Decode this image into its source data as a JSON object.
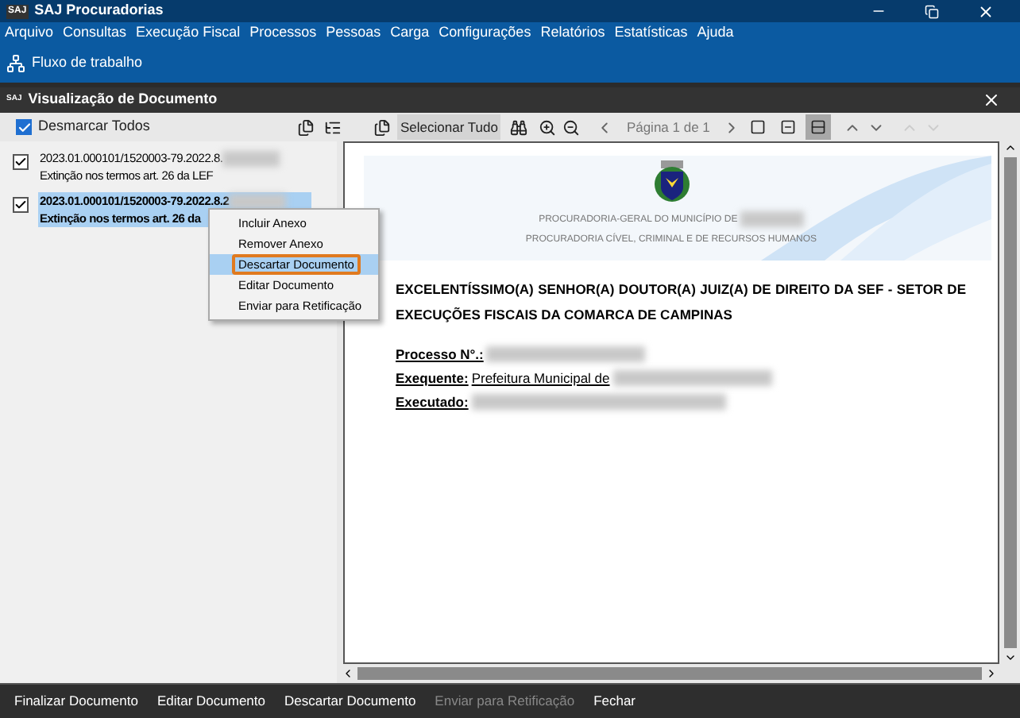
{
  "window": {
    "title": "SAJ Procuradorias",
    "logo": "SAJ"
  },
  "menu": [
    "Arquivo",
    "Consultas",
    "Execução Fiscal",
    "Processos",
    "Pessoas",
    "Carga",
    "Configurações",
    "Relatórios",
    "Estatísticas",
    "Ajuda"
  ],
  "quick_toolbar": [
    {
      "label": "Fluxo de trabalho"
    }
  ],
  "document_window": {
    "title": "Visualização de Documento",
    "logo": "SAJ",
    "select_all": {
      "label": "Desmarcar Todos",
      "checked": true
    },
    "toolbar": {
      "select_all_button": "Selecionar Tudo",
      "page": "Página 1 de 1",
      "view_modes": [
        {
          "selected": false
        },
        {
          "selected": false
        },
        {
          "selected": true
        }
      ]
    },
    "documents": [
      {
        "number": "2023.01.000101/1520003-79.2022.8.",
        "description": "Extinção nos termos art. 26 da LEF",
        "checked": true,
        "selected": false
      },
      {
        "number": "2023.01.000101/1520003-79.2022.8.2",
        "description": "Extinção nos termos art. 26 da",
        "checked": true,
        "selected": true
      }
    ],
    "context_menu": [
      {
        "label": "Incluir Anexo",
        "selected": false
      },
      {
        "label": "Remover Anexo",
        "selected": false
      },
      {
        "label": "Descartar Documento",
        "selected": true
      },
      {
        "label": "Editar Documento",
        "selected": false
      },
      {
        "label": "Enviar para Retificação",
        "selected": false
      }
    ],
    "document": {
      "header": [
        "PROCURADORIA-GERAL DO MUNICÍPIO DE",
        "PROCURADORIA CÍVEL, CRIMINAL E DE RECURSOS HUMANOS"
      ],
      "address": "EXCELENTÍSSIMO(A) SENHOR(A) DOUTOR(A) JUIZ(A) DE DIREITO DA SEF - SETOR DE EXECUÇÕES FISCAIS DA COMARCA DE CAMPINAS",
      "fields": [
        {
          "label": "Processo N°.:"
        },
        {
          "label": "Exequente:",
          "value": "Prefeitura Municipal de"
        },
        {
          "label": "Executado:"
        }
      ]
    },
    "actions": [
      {
        "label": "Finalizar Documento",
        "disabled": false
      },
      {
        "label": "Editar Documento",
        "disabled": false
      },
      {
        "label": "Descartar Documento",
        "disabled": false
      },
      {
        "label": "Enviar para Retificação",
        "disabled": true
      },
      {
        "label": "Fechar",
        "disabled": false
      }
    ]
  }
}
